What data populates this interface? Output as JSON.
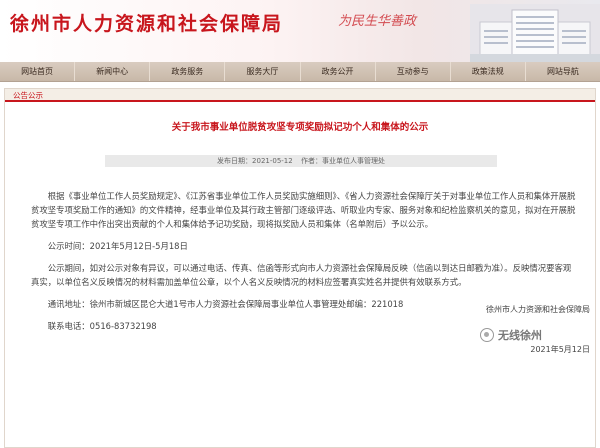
{
  "header": {
    "site_title": "徐州市人力资源和社会保障局",
    "slogan": "为民生华善政"
  },
  "nav": {
    "items": [
      "网站首页",
      "新闻中心",
      "政务服务",
      "服务大厅",
      "政务公开",
      "互动参与",
      "政策法规",
      "网站导航"
    ]
  },
  "section": {
    "tab_label": "公告公示"
  },
  "article": {
    "title": "关于我市事业单位脱贫攻坚专项奖励拟记功个人和集体的公示",
    "published_label": "发布日期：2021-05-12",
    "author_label": "作者：事业单位人事管理处",
    "paragraphs": [
      "根据《事业单位工作人员奖励规定》、《江苏省事业单位工作人员奖励实施细则》、《省人力资源社会保障厅关于对事业单位工作人员和集体开展脱贫攻坚专项奖励工作的通知》的文件精神，经事业单位及其行政主管部门逐级评选、听取业内专家、服务对象和纪检监察机关的意见，拟对在开展脱贫攻坚专项工作中作出突出贡献的个人和集体给予记功奖励，现将拟奖励人员和集体（名单附后）予以公示。",
      "公示时间：2021年5月12日-5月18日",
      "公示期间，如对公示对象有异议，可以通过电话、传真、信函等形式向市人力资源社会保障局反映（信函以到达日邮戳为准）。反映情况要客观真实，以单位名义反映情况的材料需加盖单位公章，以个人名义反映情况的材料应签署真实姓名并提供有效联系方式。",
      "通讯地址：徐州市新城区昆仑大道1号市人力资源社会保障局事业单位人事管理处邮编：221018",
      "联系电话：0516-83732198"
    ],
    "signature": "徐州市人力资源和社会保障局",
    "date": "2021年5月12日"
  },
  "watermark": {
    "text": "无线徐州"
  },
  "colors": {
    "brand_red": "#c8161d",
    "nav_bg": "#d2c4b6"
  }
}
